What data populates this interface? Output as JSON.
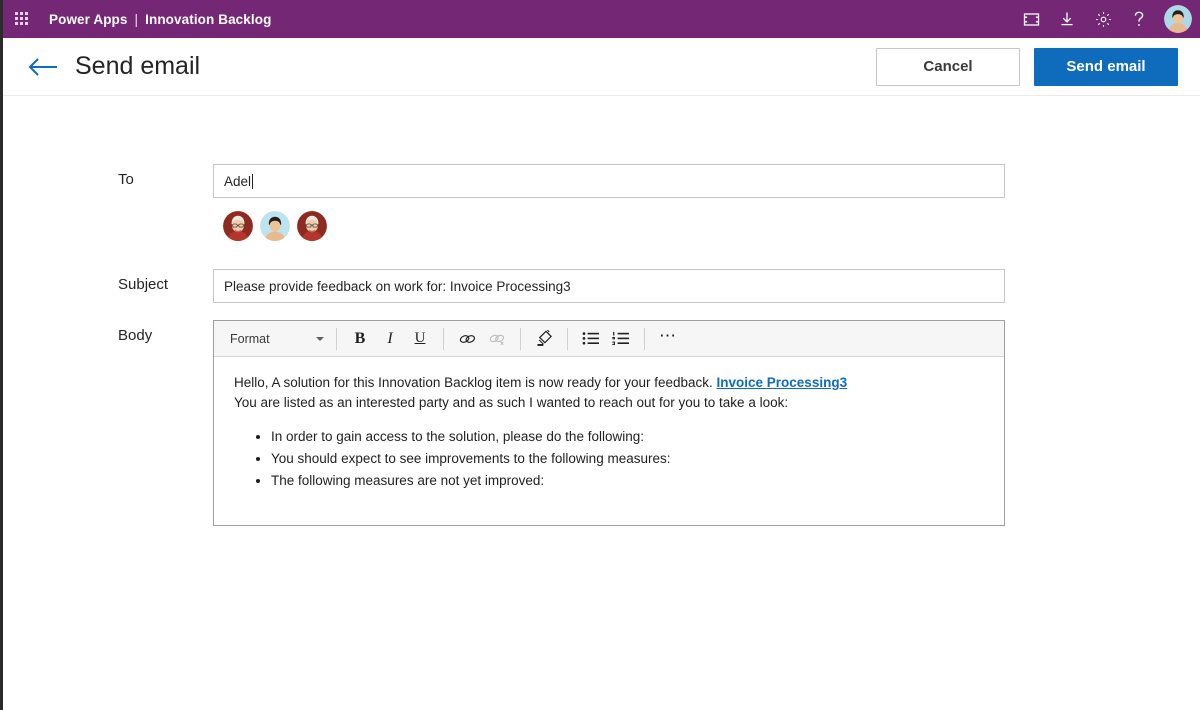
{
  "suitebar": {
    "waffle_icon": "app-launcher-waffle-icon",
    "app_name": "Power Apps",
    "separator": "|",
    "environment": "Innovation Backlog",
    "icons": [
      {
        "name": "fit-to-screen-icon",
        "glyph": "full-screen"
      },
      {
        "name": "download-icon",
        "glyph": "download"
      },
      {
        "name": "settings-gear-icon",
        "glyph": "gear"
      },
      {
        "name": "help-icon",
        "glyph": "?"
      }
    ],
    "account_avatar_alt": "user-account-photo",
    "background_color": "#742774"
  },
  "command_bar": {
    "back_label": "back-arrow",
    "title": "Send email",
    "cancel_label": "Cancel",
    "send_label": "Send email",
    "primary_color": "#0f6cbd"
  },
  "form": {
    "to": {
      "label": "To",
      "value": "Adel",
      "placeholder": "",
      "suggestions": [
        {
          "name": "recipient-avatar-1"
        },
        {
          "name": "recipient-avatar-2"
        },
        {
          "name": "recipient-avatar-3"
        }
      ]
    },
    "subject": {
      "label": "Subject",
      "value": "Please provide feedback on work for: Invoice Processing3",
      "placeholder": ""
    },
    "body": {
      "label": "Body",
      "toolbar": {
        "format_label": "Format",
        "bold_label": "B",
        "italic_label": "I",
        "underline_label": "U",
        "link_label": "link-icon",
        "unlink_label": "unlink-icon",
        "clear_format_label": "clear-formatting-icon",
        "bulleted_list_label": "bulleted-list-icon",
        "numbered_list_label": "numbered-list-icon",
        "more_label": "⋯"
      },
      "content": {
        "paragraph_1_before_link": "Hello, A solution for this Innovation Backlog item is now ready for your feedback. ",
        "link_text": "Invoice Processing3",
        "paragraph_2": "You are listed as an interested party and as such I wanted to reach out for you to take a look:",
        "bullets": [
          "In order to gain access to the solution, please do the following:",
          "You should expect to see improvements to the following measures:",
          "The following measures are not yet improved:"
        ]
      }
    }
  }
}
